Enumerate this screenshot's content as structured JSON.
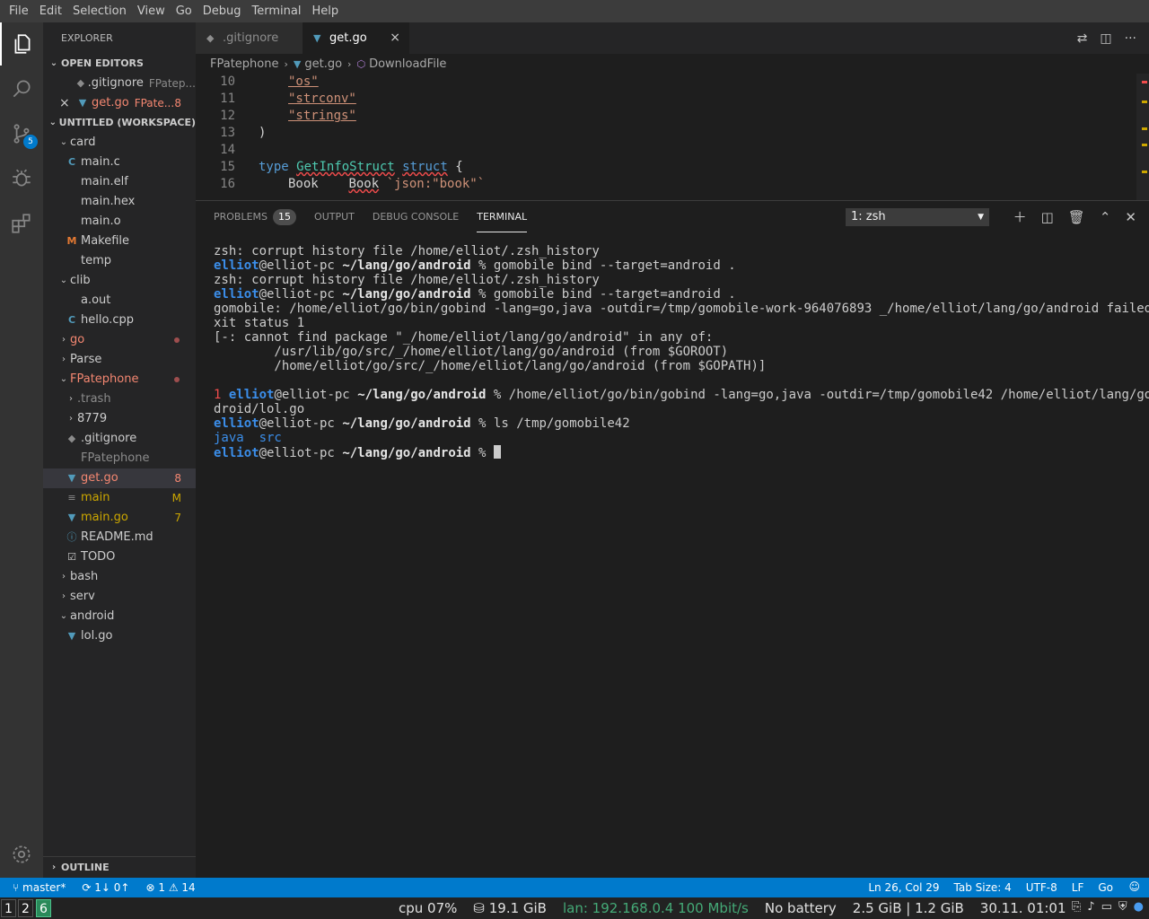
{
  "menu": [
    "File",
    "Edit",
    "Selection",
    "View",
    "Go",
    "Debug",
    "Terminal",
    "Help"
  ],
  "activity": {
    "scm_badge": "5"
  },
  "explorer": {
    "title": "EXPLORER",
    "open_editors_label": "OPEN EDITORS",
    "open_editors": [
      {
        "name": ".gitignore",
        "desc": "FPatep..."
      },
      {
        "name": "get.go",
        "desc": "FPate...",
        "count": "8"
      }
    ],
    "workspace_label": "UNTITLED (WORKSPACE)",
    "tree": [
      {
        "name": "card",
        "chev": "⌄"
      },
      {
        "name": "main.c",
        "icon": "C"
      },
      {
        "name": "main.elf"
      },
      {
        "name": "main.hex"
      },
      {
        "name": "main.o"
      },
      {
        "name": "Makefile",
        "icon": "M"
      },
      {
        "name": "temp"
      },
      {
        "name": "clib",
        "chev": "⌄"
      },
      {
        "name": "a.out"
      },
      {
        "name": "hello.cpp",
        "icon": "C"
      },
      {
        "name": "go",
        "chev": "›"
      },
      {
        "name": "Parse",
        "chev": "›"
      },
      {
        "name": "FPatephone",
        "chev": "⌄"
      },
      {
        "name": ".trash",
        "chev": "›"
      },
      {
        "name": "8779",
        "chev": "›"
      },
      {
        "name": ".gitignore"
      },
      {
        "name": "FPatephone"
      },
      {
        "name": "get.go",
        "count": "8"
      },
      {
        "name": "main",
        "count": "M"
      },
      {
        "name": "main.go",
        "count": "7"
      },
      {
        "name": "README.md",
        "icon": "ⓘ"
      },
      {
        "name": "TODO",
        "icon": "☑"
      },
      {
        "name": "bash",
        "chev": "›"
      },
      {
        "name": "serv",
        "chev": "›"
      },
      {
        "name": "android",
        "chev": "⌄"
      },
      {
        "name": "lol.go"
      }
    ],
    "outline_label": "OUTLINE"
  },
  "tabs": [
    {
      "label": ".gitignore"
    },
    {
      "label": "get.go",
      "close": "×"
    }
  ],
  "breadcrumb": [
    "FPatephone",
    "get.go",
    "DownloadFile"
  ],
  "code": {
    "line_numbers": [
      "10",
      "11",
      "12",
      "13",
      "14",
      "15",
      "16"
    ],
    "os": "\"os\"",
    "strconv": "\"strconv\"",
    "strings": "\"strings\"",
    "paren": ")",
    "kw_type": "type",
    "type_name": "GetInfoStruct",
    "kw_struct": "struct",
    "brace": "{",
    "field1": "Book",
    "field1_type": "Book",
    "field1_tag": "`json:\"book\"`"
  },
  "panel": {
    "tabs": [
      "PROBLEMS",
      "OUTPUT",
      "DEBUG CONSOLE",
      "TERMINAL"
    ],
    "problems_count": "15",
    "terminal_select": "1: zsh"
  },
  "terminal": {
    "user": "elliot",
    "host": "@elliot-pc",
    "path": "~/lang/go/android",
    "prompt_char": "%",
    "warn1": "zsh: corrupt history file /home/elliot/.zsh_history",
    "cmd1": "gomobile bind --target=android .",
    "warn2": "zsh: corrupt history file /home/elliot/.zsh_history",
    "cmd2": "gomobile bind --target=android .",
    "out1": "gomobile: /home/elliot/go/bin/gobind -lang=go,java -outdir=/tmp/gomobile-work-964076893 _/home/elliot/lang/go/android failed: e",
    "out2": "xit status 1",
    "out3": "[-: cannot find package \"_/home/elliot/lang/go/android\" in any of:",
    "out4": "        /usr/lib/go/src/_/home/elliot/lang/go/android (from $GOROOT)",
    "out5": "        /home/elliot/go/src/_/home/elliot/lang/go/android (from $GOPATH)]",
    "exit_code": "1",
    "cmd3": "/home/elliot/go/bin/gobind -lang=go,java -outdir=/tmp/gomobile42 /home/elliot/lang/go/an",
    "cmd3_wrap": "droid/lol.go",
    "cmd4": "ls /tmp/gomobile42",
    "ls_java": "java",
    "ls_src": "src"
  },
  "status": {
    "branch": "master*",
    "sync": "1↓ 0↑",
    "errors": "1",
    "warnings": "14",
    "position": "Ln 26, Col 29",
    "tab_size": "Tab Size: 4",
    "encoding": "UTF-8",
    "eol": "LF",
    "language": "Go"
  },
  "system": {
    "workspaces": [
      "1",
      "2",
      "6"
    ],
    "cpu": "cpu   07%",
    "disk": "⛁ 19.1 GiB",
    "lan": "lan: 192.168.0.4 100 Mbit/s",
    "battery": "No battery",
    "mem": "2.5 GiB | 1.2 GiB",
    "date": "30.11. 01:01"
  }
}
